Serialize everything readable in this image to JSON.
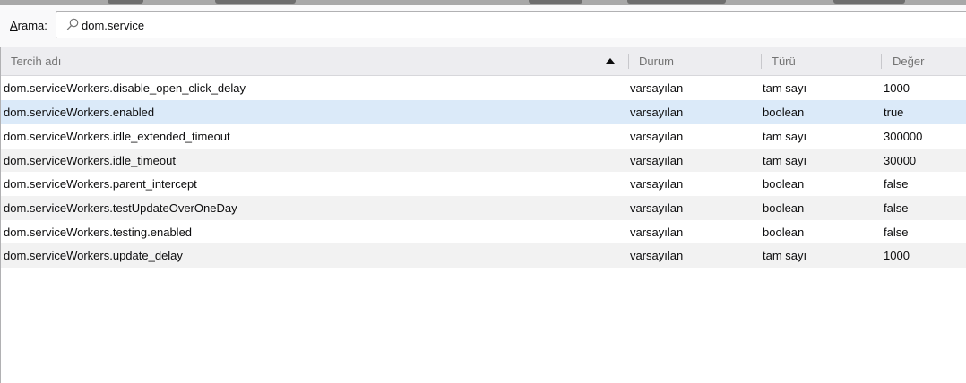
{
  "search": {
    "label_accel": "A",
    "label_rest": "rama:",
    "value": "dom.service"
  },
  "table": {
    "columns": {
      "name": "Tercih adı",
      "status": "Durum",
      "type": "Türü",
      "value": "Değer"
    },
    "rows": [
      {
        "name": "dom.serviceWorkers.disable_open_click_delay",
        "status": "varsayılan",
        "type": "tam sayı",
        "value": "1000"
      },
      {
        "name": "dom.serviceWorkers.enabled",
        "status": "varsayılan",
        "type": "boolean",
        "value": "true"
      },
      {
        "name": "dom.serviceWorkers.idle_extended_timeout",
        "status": "varsayılan",
        "type": "tam sayı",
        "value": "300000"
      },
      {
        "name": "dom.serviceWorkers.idle_timeout",
        "status": "varsayılan",
        "type": "tam sayı",
        "value": "30000"
      },
      {
        "name": "dom.serviceWorkers.parent_intercept",
        "status": "varsayılan",
        "type": "boolean",
        "value": "false"
      },
      {
        "name": "dom.serviceWorkers.testUpdateOverOneDay",
        "status": "varsayılan",
        "type": "boolean",
        "value": "false"
      },
      {
        "name": "dom.serviceWorkers.testing.enabled",
        "status": "varsayılan",
        "type": "boolean",
        "value": "false"
      },
      {
        "name": "dom.serviceWorkers.update_delay",
        "status": "varsayılan",
        "type": "tam sayı",
        "value": "1000"
      }
    ],
    "selected_row": 1
  },
  "colors": {
    "selected_row_bg": "#dbeaf9",
    "alt_row_bg": "#f2f2f2",
    "header_bg": "#ededf0"
  }
}
